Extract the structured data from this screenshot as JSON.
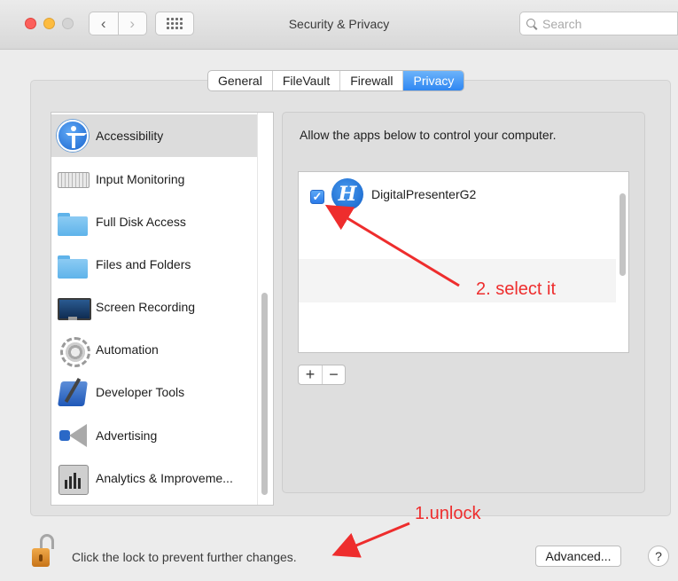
{
  "window": {
    "title": "Security & Privacy",
    "nav_back": "‹",
    "nav_forward": "›"
  },
  "search": {
    "placeholder": "Search"
  },
  "tabs": [
    {
      "label": "General",
      "active": false
    },
    {
      "label": "FileVault",
      "active": false
    },
    {
      "label": "Firewall",
      "active": false
    },
    {
      "label": "Privacy",
      "active": true
    }
  ],
  "sidebar": {
    "items": [
      {
        "label": "Accessibility",
        "icon": "accessibility-icon",
        "selected": true
      },
      {
        "label": "Input Monitoring",
        "icon": "keyboard-icon"
      },
      {
        "label": "Full Disk Access",
        "icon": "folder-icon"
      },
      {
        "label": "Files and Folders",
        "icon": "folder-icon"
      },
      {
        "label": "Screen Recording",
        "icon": "monitor-icon"
      },
      {
        "label": "Automation",
        "icon": "gear-icon"
      },
      {
        "label": "Developer Tools",
        "icon": "developer-tools-icon"
      },
      {
        "label": "Advertising",
        "icon": "megaphone-icon"
      },
      {
        "label": "Analytics & Improveme...",
        "icon": "analytics-icon"
      }
    ]
  },
  "pane": {
    "description": "Allow the apps below to control your computer.",
    "apps": [
      {
        "name": "DigitalPresenterG2",
        "checked": true,
        "icon_letter": "H"
      }
    ],
    "add_label": "+",
    "remove_label": "−"
  },
  "footer": {
    "lock_text": "Click the lock to prevent further changes.",
    "advanced_label": "Advanced...",
    "help_label": "?"
  },
  "annotations": {
    "select": "2. select it",
    "unlock": "1.unlock"
  },
  "colors": {
    "accent": "#2f87f2",
    "annotation": "#ee2d2d"
  }
}
